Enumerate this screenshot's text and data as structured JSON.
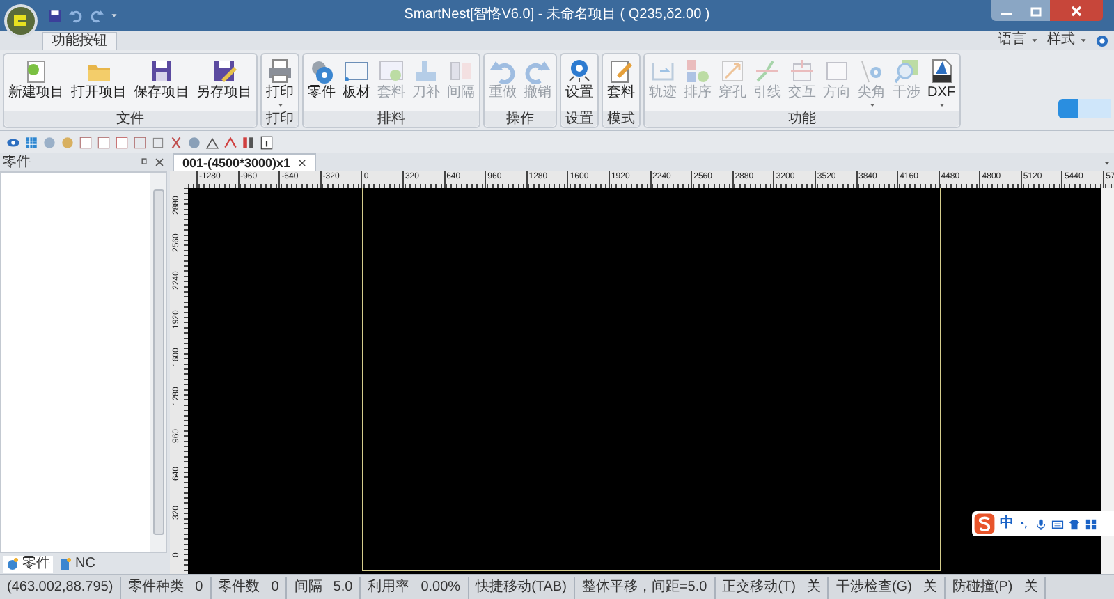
{
  "window": {
    "title": "SmartNest[智恪V6.0] - 未命名项目 ( Q235,δ2.00 )"
  },
  "ribbon_tabs": [
    {
      "label": "功能按钮",
      "selected": true
    }
  ],
  "menu_right": [
    {
      "label": "语言"
    },
    {
      "label": "样式"
    }
  ],
  "ribbon_groups": [
    {
      "label": "文件",
      "items": [
        {
          "label": "新建项目",
          "disabled": false,
          "dropdown": false
        },
        {
          "label": "打开项目",
          "disabled": false,
          "dropdown": false
        },
        {
          "label": "保存项目",
          "disabled": false,
          "dropdown": false
        },
        {
          "label": "另存项目",
          "disabled": false,
          "dropdown": false
        }
      ]
    },
    {
      "label": "打印",
      "items": [
        {
          "label": "打印",
          "disabled": false,
          "dropdown": true
        }
      ]
    },
    {
      "label": "排料",
      "items": [
        {
          "label": "零件",
          "disabled": false,
          "dropdown": false
        },
        {
          "label": "板材",
          "disabled": false,
          "dropdown": false
        },
        {
          "label": "套料",
          "disabled": true,
          "dropdown": false
        },
        {
          "label": "刀补",
          "disabled": true,
          "dropdown": false
        },
        {
          "label": "间隔",
          "disabled": true,
          "dropdown": false
        }
      ]
    },
    {
      "label": "操作",
      "items": [
        {
          "label": "重做",
          "disabled": true,
          "dropdown": false
        },
        {
          "label": "撤销",
          "disabled": true,
          "dropdown": false
        }
      ]
    },
    {
      "label": "设置",
      "items": [
        {
          "label": "设置",
          "disabled": false,
          "dropdown": false
        }
      ]
    },
    {
      "label": "模式",
      "items": [
        {
          "label": "套料",
          "disabled": false,
          "dropdown": false
        }
      ]
    },
    {
      "label": "功能",
      "items": [
        {
          "label": "轨迹",
          "disabled": true,
          "dropdown": false
        },
        {
          "label": "排序",
          "disabled": true,
          "dropdown": false
        },
        {
          "label": "穿孔",
          "disabled": true,
          "dropdown": false
        },
        {
          "label": "引线",
          "disabled": true,
          "dropdown": false
        },
        {
          "label": "交互",
          "disabled": true,
          "dropdown": false
        },
        {
          "label": "方向",
          "disabled": true,
          "dropdown": false
        },
        {
          "label": "尖角",
          "disabled": true,
          "dropdown": true
        },
        {
          "label": "干涉",
          "disabled": true,
          "dropdown": false
        },
        {
          "label": "DXF",
          "disabled": false,
          "dropdown": true
        }
      ]
    }
  ],
  "parts_panel": {
    "title": "零件",
    "tabs": [
      {
        "label": "零件",
        "selected": true
      },
      {
        "label": "NC",
        "selected": false
      }
    ]
  },
  "document_tab": {
    "label": "001-(4500*3000)x1"
  },
  "ruler": {
    "x_labels": [
      "-1280",
      "-960",
      "-640",
      "-320",
      "0",
      "320",
      "640",
      "960",
      "1280",
      "1600",
      "1920",
      "2240",
      "2560",
      "2880",
      "3200",
      "3520",
      "3840",
      "4160",
      "4480",
      "4800",
      "5120",
      "5440",
      "57"
    ],
    "y_labels": [
      "2880",
      "2560",
      "2240",
      "1920",
      "1600",
      "1280",
      "960",
      "640",
      "320",
      "0"
    ]
  },
  "ime_toolbar": {
    "label": "中"
  },
  "status_bar": [
    {
      "label": "(463.002,88.795)"
    },
    {
      "label": "零件种类",
      "value": "0"
    },
    {
      "label": "零件数",
      "value": "0"
    },
    {
      "label": "间隔",
      "value": "5.0"
    },
    {
      "label": "利用率",
      "value": "0.00%"
    },
    {
      "label": "快捷移动(TAB)"
    },
    {
      "label": "整体平移，间距=5.0"
    },
    {
      "label": "正交移动(T)",
      "value": "关"
    },
    {
      "label": "干涉检查(G)",
      "value": "关"
    },
    {
      "label": "防碰撞(P)",
      "value": "关"
    }
  ]
}
